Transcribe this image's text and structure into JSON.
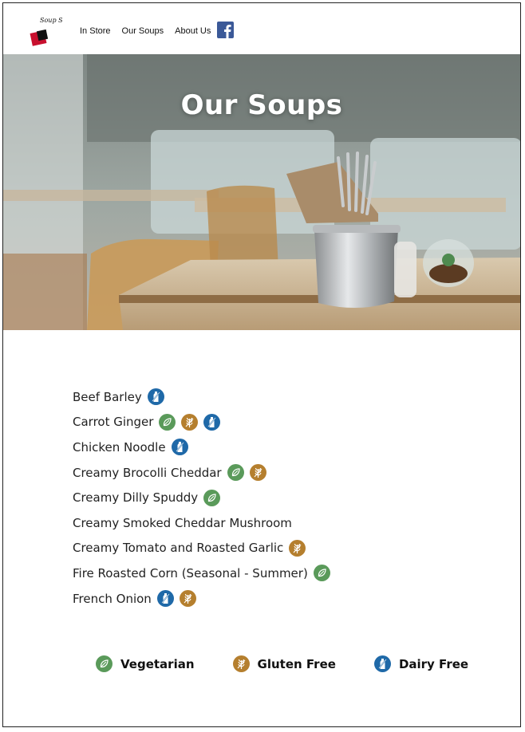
{
  "nav": {
    "logo_text": "Soup Surreal",
    "links": [
      "In Store",
      "Our Soups",
      "About Us"
    ],
    "social_icon": "facebook-icon"
  },
  "hero": {
    "title": "Our Soups"
  },
  "soups": [
    {
      "name": "Beef Barley",
      "icons": [
        "dairy-free"
      ]
    },
    {
      "name": "Carrot Ginger",
      "icons": [
        "vegetarian",
        "gluten-free",
        "dairy-free"
      ]
    },
    {
      "name": "Chicken Noodle",
      "icons": [
        "dairy-free"
      ]
    },
    {
      "name": "Creamy Brocolli Cheddar",
      "icons": [
        "vegetarian",
        "gluten-free"
      ]
    },
    {
      "name": "Creamy Dilly Spuddy",
      "icons": [
        "vegetarian"
      ]
    },
    {
      "name": "Creamy Smoked Cheddar Mushroom",
      "icons": []
    },
    {
      "name": "Creamy Tomato and Roasted Garlic",
      "icons": [
        "gluten-free"
      ]
    },
    {
      "name": "Fire Roasted Corn (Seasonal - Summer)",
      "icons": [
        "vegetarian"
      ]
    },
    {
      "name": "French Onion",
      "icons": [
        "dairy-free",
        "gluten-free"
      ]
    }
  ],
  "legend": [
    {
      "key": "vegetarian",
      "label": "Vegetarian"
    },
    {
      "key": "gluten-free",
      "label": "Gluten Free"
    },
    {
      "key": "dairy-free",
      "label": "Dairy Free"
    }
  ],
  "colors": {
    "vegetarian": "#5a9a5a",
    "gluten-free": "#b57f2e",
    "dairy-free": "#1f69a8",
    "facebook": "#3b5998"
  }
}
